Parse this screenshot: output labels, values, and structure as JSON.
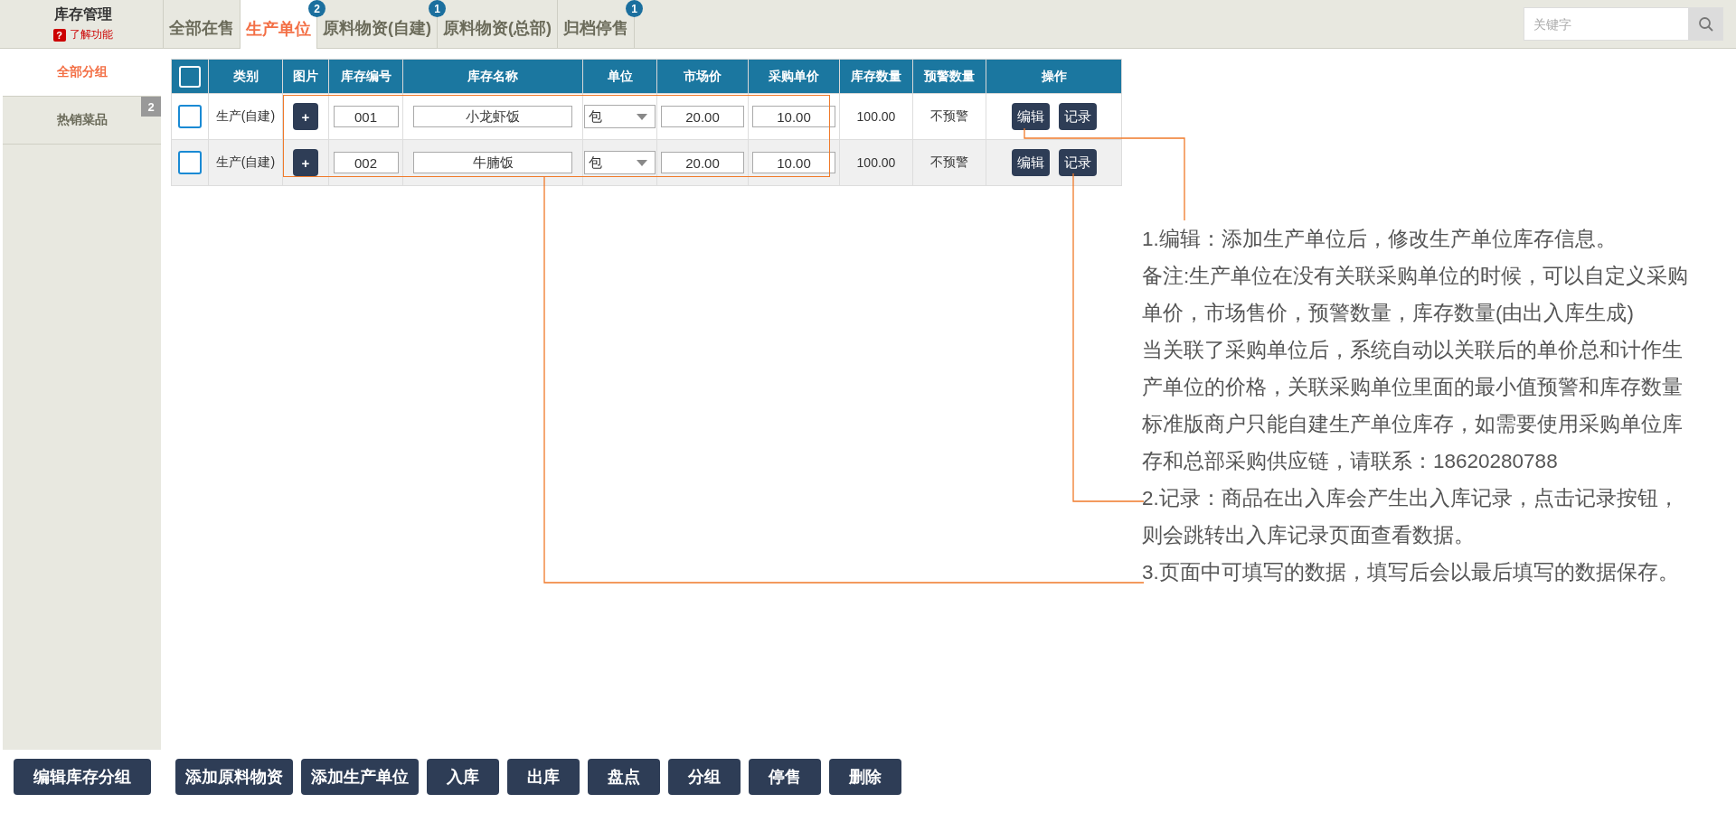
{
  "header": {
    "title": "库存管理",
    "help_icon": "?",
    "help_link": "了解功能"
  },
  "tabs": [
    {
      "label": "全部在售",
      "selected": false
    },
    {
      "label": "生产单位",
      "selected": true,
      "badge": "2"
    },
    {
      "label": "原料物资(自建)",
      "selected": false,
      "badge": "1"
    },
    {
      "label": "原料物资(总部)",
      "selected": false
    },
    {
      "label": "归档停售",
      "selected": false,
      "badge": "1"
    }
  ],
  "search": {
    "placeholder": "关键字"
  },
  "sidebar": {
    "items": [
      {
        "label": "全部分组",
        "selected": true
      },
      {
        "label": "热销菜品",
        "selected": false,
        "badge": "2"
      }
    ]
  },
  "table": {
    "header_checkbox": {
      "checked": false
    },
    "columns": [
      "类别",
      "图片",
      "库存编号",
      "库存名称",
      "单位",
      "市场价",
      "采购单价",
      "库存数量",
      "预警数量",
      "操作"
    ],
    "rows": [
      {
        "checked": false,
        "category": "生产(自建)",
        "image_button": "+",
        "code": "001",
        "name": "小龙虾饭",
        "unit": "包",
        "market_price": "20.00",
        "purchase_price": "10.00",
        "stock": "100.00",
        "warning": "不预警",
        "actions": [
          "编辑",
          "记录"
        ]
      },
      {
        "checked": false,
        "category": "生产(自建)",
        "image_button": "+",
        "code": "002",
        "name": "牛腩饭",
        "unit": "包",
        "market_price": "20.00",
        "purchase_price": "10.00",
        "stock": "100.00",
        "warning": "不预警",
        "actions": [
          "编辑",
          "记录"
        ]
      }
    ]
  },
  "annotation": {
    "lines": [
      "1.编辑：添加生产单位后，修改生产单位库存信息。",
      "备注:生产单位在没有关联采购单位的时候，可以自定义采购",
      "单价，市场售价，预警数量，库存数量(由出入库生成)",
      "当关联了采购单位后，系统自动以关联后的单价总和计作生",
      "产单位的价格，关联采购单位里面的最小值预警和库存数量",
      "标准版商户只能自建生产单位库存，如需要使用采购单位库",
      "存和总部采购供应链，请联系：18620280788",
      "2.记录：商品在出入库会产生出入库记录，点击记录按钮，",
      "则会跳转出入库记录页面查看数据。",
      "3.页面中可填写的数据，填写后会以最后填写的数据保存。"
    ]
  },
  "buttons": [
    "编辑库存分组",
    "添加原料物资",
    "添加生产单位",
    "入库",
    "出库",
    "盘点",
    "分组",
    "停售",
    "删除"
  ]
}
